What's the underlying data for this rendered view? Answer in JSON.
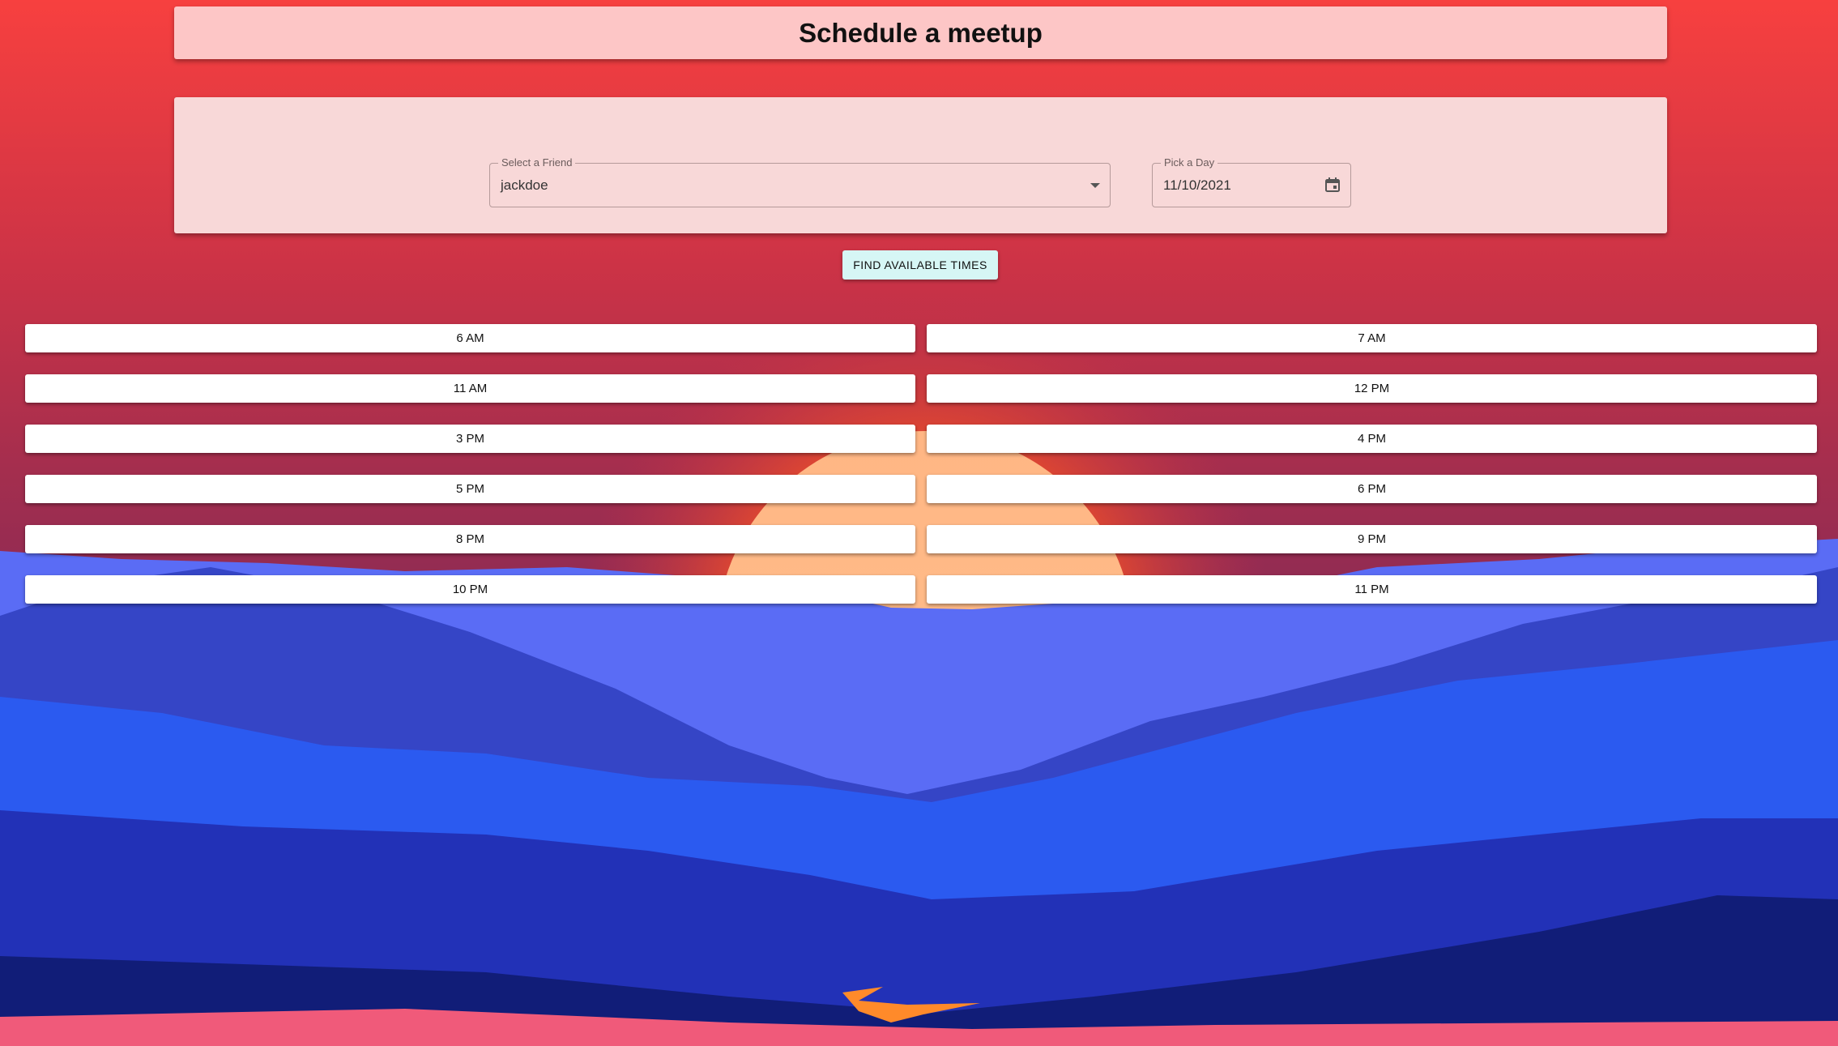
{
  "header": {
    "title": "Schedule a meetup"
  },
  "form": {
    "friend_label": "Select a Friend",
    "friend_value": "jackdoe",
    "day_label": "Pick a Day",
    "day_value": "11/10/2021"
  },
  "find_button_label": "FIND AVAILABLE TIMES",
  "time_slots": [
    "6 AM",
    "7 AM",
    "11 AM",
    "12 PM",
    "3 PM",
    "4 PM",
    "5 PM",
    "6 PM",
    "8 PM",
    "9 PM",
    "10 PM",
    "11 PM"
  ],
  "colors": {
    "title_card": "#fdc6c6",
    "form_card": "#f8d8d8",
    "button": "#d6f6f5",
    "sky_top": "#f7403f",
    "sun": "#ffb57e"
  },
  "icons": {
    "select_caret": "chevron-down-icon",
    "calendar": "calendar-icon"
  }
}
